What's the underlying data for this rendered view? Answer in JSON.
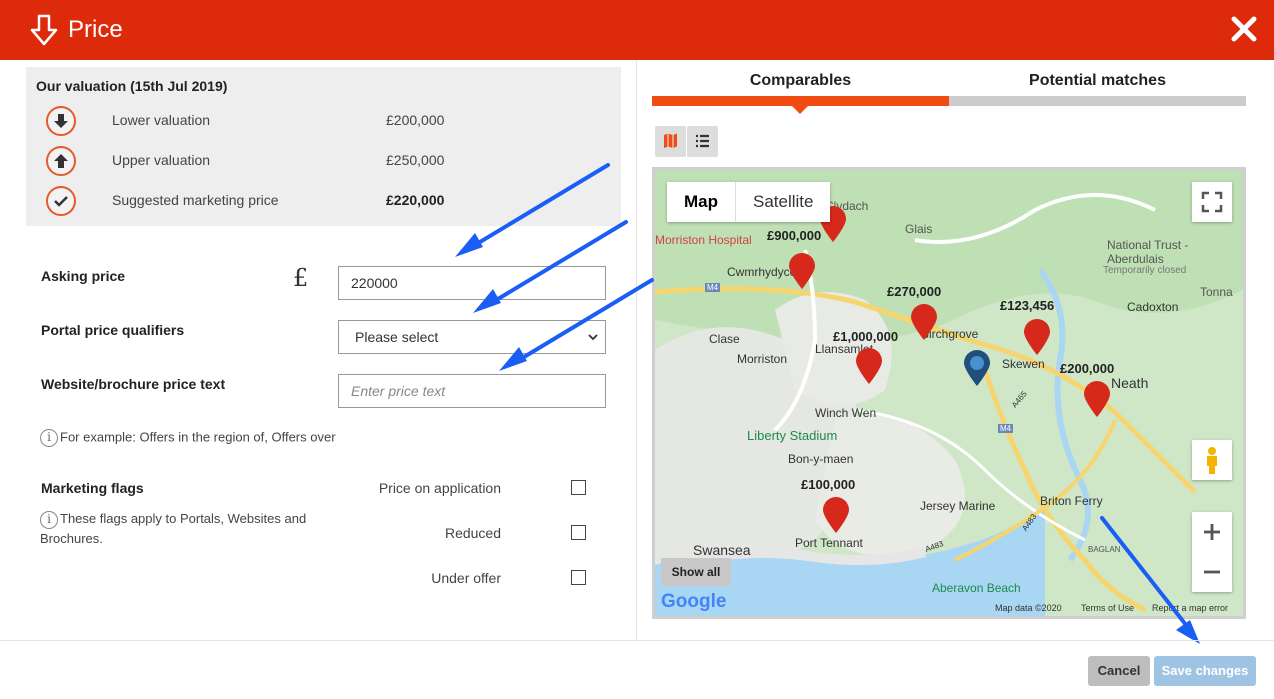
{
  "header": {
    "title": "Price"
  },
  "valuation": {
    "heading": "Our valuation (15th Jul 2019)",
    "rows": [
      {
        "icon": "arrow-down-icon",
        "label": "Lower valuation",
        "value": "£200,000"
      },
      {
        "icon": "arrow-up-icon",
        "label": "Upper valuation",
        "value": "£250,000"
      },
      {
        "icon": "check-icon",
        "label": "Suggested marketing price",
        "value": "£220,000"
      }
    ]
  },
  "form": {
    "asking_price_label": "Asking price",
    "currency_symbol": "£",
    "asking_price_value": "220000",
    "qualifiers_label": "Portal price qualifiers",
    "qualifiers_selected": "Please select",
    "price_text_label": "Website/brochure price text",
    "price_text_placeholder": "Enter price text",
    "price_text_help": "For example: Offers in the region of, Offers over",
    "flags_label": "Marketing flags",
    "flags_help": "These flags apply to Portals, Websites and Brochures.",
    "flags": [
      {
        "label": "Price on application",
        "checked": false
      },
      {
        "label": "Reduced",
        "checked": false
      },
      {
        "label": "Under offer",
        "checked": false
      }
    ]
  },
  "tabs": {
    "comparables": "Comparables",
    "potential_matches": "Potential matches",
    "active": "comparables"
  },
  "map": {
    "type_map": "Map",
    "type_satellite": "Satellite",
    "show_all": "Show all",
    "credits": {
      "google": "Google",
      "data": "Map data ©2020",
      "terms": "Terms of Use",
      "report": "Report a map error"
    },
    "places": [
      "Clydach",
      "Glais",
      "Morriston Hospital",
      "Cwmrhydyceirw",
      "National Trust - Aberdulais",
      "Temporarily closed",
      "Tonna",
      "Cadoxton",
      "Clase",
      "Morriston",
      "Llansamlet",
      "Birchgrove",
      "Skewen",
      "Neath",
      "Winch Wen",
      "Liberty Stadium",
      "Bon-y-maen",
      "Briton Ferry",
      "Jersey Marine",
      "Swansea",
      "Port Tennant",
      "Aberavon Beach",
      "BAGLAN",
      "M4",
      "A465",
      "A483"
    ],
    "markers": [
      "£900,000",
      "£270,000",
      "£123,456",
      "£1,000,000",
      "£200,000",
      "£100,000"
    ]
  },
  "footer": {
    "cancel": "Cancel",
    "save": "Save changes"
  },
  "colors": {
    "header": "#dd2a0a",
    "accent": "#f04c14",
    "save_disabled": "#9fc3e3",
    "cancel": "#bdbdbd",
    "annotation_arrow": "#1a5ef5"
  }
}
